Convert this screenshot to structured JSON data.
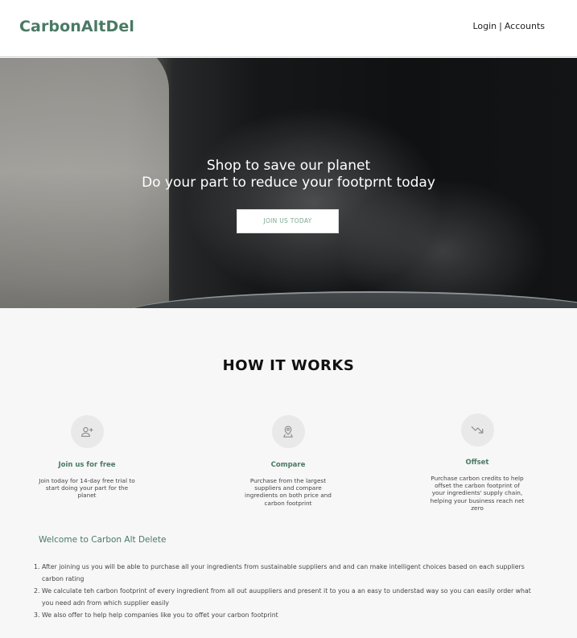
{
  "header": {
    "logo": "CarbonAltDel",
    "login_label": "Login",
    "separator": "|",
    "accounts_label": "Accounts"
  },
  "hero": {
    "line1": "Shop to save our planet",
    "line2": "Do your part to reduce your footprnt today",
    "cta_label": "JOIN US TODAY"
  },
  "how": {
    "title": "HOW IT WORKS",
    "steps": [
      {
        "icon": "add-user-icon",
        "title": "Join us for free",
        "description": "Join today for 14-day free trial to start doing your part for the planet"
      },
      {
        "icon": "map-pin-icon",
        "title": "Compare",
        "description": "Purchase from the largest suppliers and compare ingredients on both price and carbon footprint"
      },
      {
        "icon": "trending-down-icon",
        "title": "Offset",
        "description": "Purchase carbon credits to help offset the carbon footprint of your ingredients' supply chain, helping your business reach net zero"
      }
    ]
  },
  "welcome": {
    "title": "Welcome to Carbon Alt Delete",
    "items": [
      "After joining us you will be able to purchase  all your ingredients from sustainable suppliers and and can make intelligent choices based on each suppliers carbon rating",
      "We calculate teh carbon footprint of every ingredient from all out auuppliers and present it to you a an easy to understad way so you can easily order what you need adn from which supplier easily",
      "We also offer to help help companies like you to offet your carbon footprint"
    ]
  },
  "colors": {
    "brand": "#4a7a64",
    "cta_text": "#7da88f",
    "background": "#f7f7f7"
  }
}
